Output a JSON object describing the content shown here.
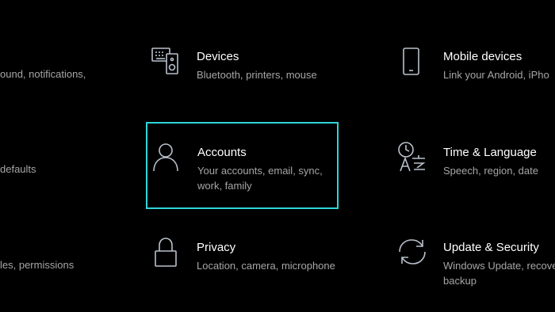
{
  "left_column": {
    "row1_desc": "ound, notifications,",
    "row2_desc": "defaults",
    "row3_desc": "les, permissions"
  },
  "tiles": {
    "devices": {
      "title": "Devices",
      "desc": "Bluetooth, printers, mouse",
      "icon": "devices-icon"
    },
    "mobile": {
      "title": "Mobile devices",
      "desc": "Link your Android, iPho",
      "icon": "mobile-phone-icon"
    },
    "accounts": {
      "title": "Accounts",
      "desc_line1": "Your accounts, email, sync,",
      "desc_line2": "work, family",
      "icon": "person-icon"
    },
    "time": {
      "title": "Time & Language",
      "desc": "Speech, region, date",
      "icon": "time-language-icon"
    },
    "privacy": {
      "title": "Privacy",
      "desc": "Location, camera, microphone",
      "icon": "lock-icon"
    },
    "update": {
      "title": "Update & Security",
      "desc_line1": "Windows Update, recove",
      "desc_line2": "backup",
      "icon": "sync-arrows-icon"
    }
  },
  "colors": {
    "background": "#000000",
    "title": "#ffffff",
    "description": "#a6a6a6",
    "icon": "#b9c1cc",
    "focus_border": "#2fd6da"
  }
}
